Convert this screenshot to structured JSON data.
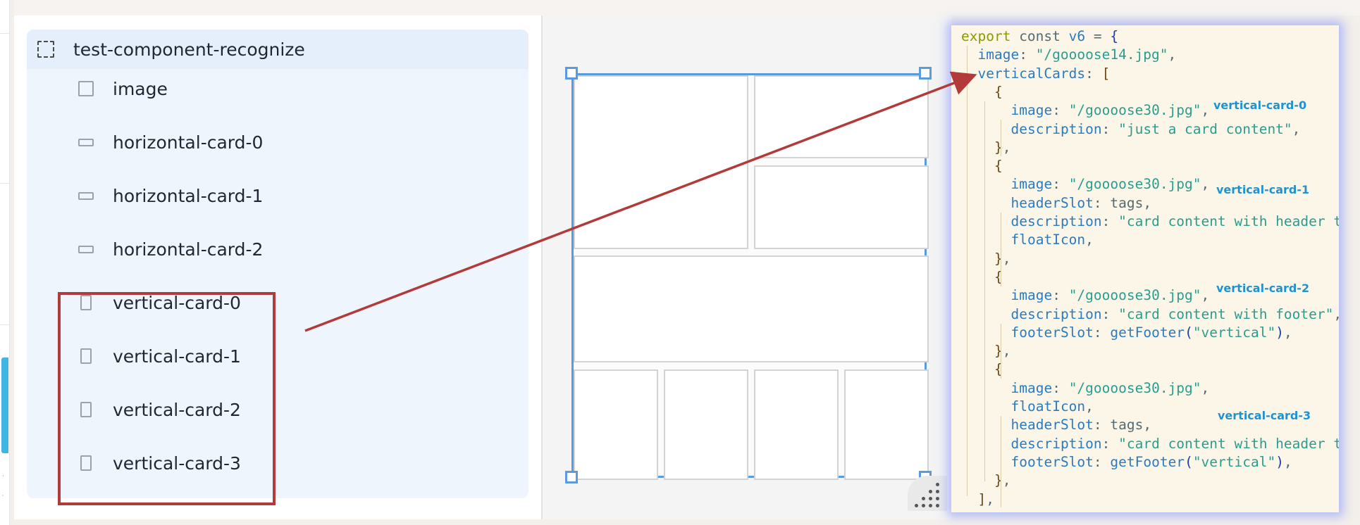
{
  "layers": {
    "root": {
      "label": "test-component-recognize",
      "icon": "dashed-frame-icon"
    },
    "items": [
      {
        "label": "image",
        "icon": "square-layer-icon"
      },
      {
        "label": "horizontal-card-0",
        "icon": "horizontal-card-icon"
      },
      {
        "label": "horizontal-card-1",
        "icon": "horizontal-card-icon"
      },
      {
        "label": "horizontal-card-2",
        "icon": "horizontal-card-icon"
      },
      {
        "label": "vertical-card-0",
        "icon": "vertical-card-icon"
      },
      {
        "label": "vertical-card-1",
        "icon": "vertical-card-icon"
      },
      {
        "label": "vertical-card-2",
        "icon": "vertical-card-icon"
      },
      {
        "label": "vertical-card-3",
        "icon": "vertical-card-icon"
      }
    ]
  },
  "code": {
    "lines": [
      {
        "indent": 0,
        "tokens": [
          [
            "kw",
            "export"
          ],
          [
            "plain",
            " const "
          ],
          [
            "var",
            "v6"
          ],
          [
            "plain",
            " = "
          ],
          [
            "brace",
            "{"
          ]
        ]
      },
      {
        "indent": 1,
        "tokens": [
          [
            "prop",
            "image"
          ],
          [
            "plain",
            ": "
          ],
          [
            "str",
            "\"/goooose14.jpg\""
          ],
          [
            "plain",
            ","
          ]
        ]
      },
      {
        "indent": 1,
        "tokens": [
          [
            "prop",
            "verticalCards"
          ],
          [
            "plain",
            ": "
          ],
          [
            "br",
            "["
          ]
        ]
      },
      {
        "indent": 2,
        "tokens": [
          [
            "br",
            "{"
          ]
        ]
      },
      {
        "indent": 3,
        "tokens": [
          [
            "prop",
            "image"
          ],
          [
            "plain",
            ": "
          ],
          [
            "str",
            "\"/goooose30.jpg\""
          ],
          [
            "plain",
            ","
          ]
        ]
      },
      {
        "indent": 3,
        "tokens": [
          [
            "prop",
            "description"
          ],
          [
            "plain",
            ": "
          ],
          [
            "str",
            "\"just a card content\""
          ],
          [
            "plain",
            ","
          ]
        ]
      },
      {
        "indent": 2,
        "tokens": [
          [
            "br",
            "}"
          ],
          [
            "plain",
            ","
          ]
        ]
      },
      {
        "indent": 2,
        "tokens": [
          [
            "br",
            "{"
          ]
        ]
      },
      {
        "indent": 3,
        "tokens": [
          [
            "prop",
            "image"
          ],
          [
            "plain",
            ": "
          ],
          [
            "str",
            "\"/goooose30.jpg\""
          ],
          [
            "plain",
            ","
          ]
        ]
      },
      {
        "indent": 3,
        "tokens": [
          [
            "prop",
            "headerSlot"
          ],
          [
            "plain",
            ": tags,"
          ]
        ]
      },
      {
        "indent": 3,
        "tokens": [
          [
            "prop",
            "description"
          ],
          [
            "plain",
            ": "
          ],
          [
            "str",
            "\"card content with header tag\""
          ]
        ]
      },
      {
        "indent": 3,
        "tokens": [
          [
            "prop",
            "floatIcon"
          ],
          [
            "plain",
            ","
          ]
        ]
      },
      {
        "indent": 2,
        "tokens": [
          [
            "br",
            "}"
          ],
          [
            "plain",
            ","
          ]
        ]
      },
      {
        "indent": 2,
        "tokens": [
          [
            "br",
            "{"
          ]
        ]
      },
      {
        "indent": 3,
        "tokens": [
          [
            "prop",
            "image"
          ],
          [
            "plain",
            ": "
          ],
          [
            "str",
            "\"/goooose30.jpg\""
          ],
          [
            "plain",
            ","
          ]
        ]
      },
      {
        "indent": 3,
        "tokens": [
          [
            "prop",
            "description"
          ],
          [
            "plain",
            ": "
          ],
          [
            "str",
            "\"card content with footer\""
          ],
          [
            "plain",
            ","
          ]
        ]
      },
      {
        "indent": 3,
        "tokens": [
          [
            "prop",
            "footerSlot"
          ],
          [
            "plain",
            ": "
          ],
          [
            "fn",
            "getFooter"
          ],
          [
            "brace",
            "("
          ],
          [
            "str",
            "\"vertical\""
          ],
          [
            "brace",
            ")"
          ],
          [
            "plain",
            ","
          ]
        ]
      },
      {
        "indent": 2,
        "tokens": [
          [
            "br",
            "}"
          ],
          [
            "plain",
            ","
          ]
        ]
      },
      {
        "indent": 2,
        "tokens": [
          [
            "br",
            "{"
          ]
        ]
      },
      {
        "indent": 3,
        "tokens": [
          [
            "prop",
            "image"
          ],
          [
            "plain",
            ": "
          ],
          [
            "str",
            "\"/goooose30.jpg\""
          ],
          [
            "plain",
            ","
          ]
        ]
      },
      {
        "indent": 3,
        "tokens": [
          [
            "prop",
            "floatIcon"
          ],
          [
            "plain",
            ","
          ]
        ]
      },
      {
        "indent": 3,
        "tokens": [
          [
            "prop",
            "headerSlot"
          ],
          [
            "plain",
            ": tags,"
          ]
        ]
      },
      {
        "indent": 3,
        "tokens": [
          [
            "prop",
            "description"
          ],
          [
            "plain",
            ": "
          ],
          [
            "str",
            "\"card content with header tag\""
          ]
        ]
      },
      {
        "indent": 3,
        "tokens": [
          [
            "prop",
            "footerSlot"
          ],
          [
            "plain",
            ": "
          ],
          [
            "fn",
            "getFooter"
          ],
          [
            "brace",
            "("
          ],
          [
            "str",
            "\"vertical\""
          ],
          [
            "brace",
            ")"
          ],
          [
            "plain",
            ","
          ]
        ]
      },
      {
        "indent": 2,
        "tokens": [
          [
            "br",
            "}"
          ],
          [
            "plain",
            ","
          ]
        ]
      },
      {
        "indent": 1,
        "tokens": [
          [
            "br",
            "]"
          ],
          [
            "plain",
            ","
          ]
        ]
      }
    ],
    "annotations": [
      "vertical-card-0",
      "vertical-card-1",
      "vertical-card-2",
      "vertical-card-3"
    ]
  },
  "colors": {
    "highlight": "#b23a3a",
    "selection": "#5a9bde",
    "annotation": "#1f93d0"
  }
}
